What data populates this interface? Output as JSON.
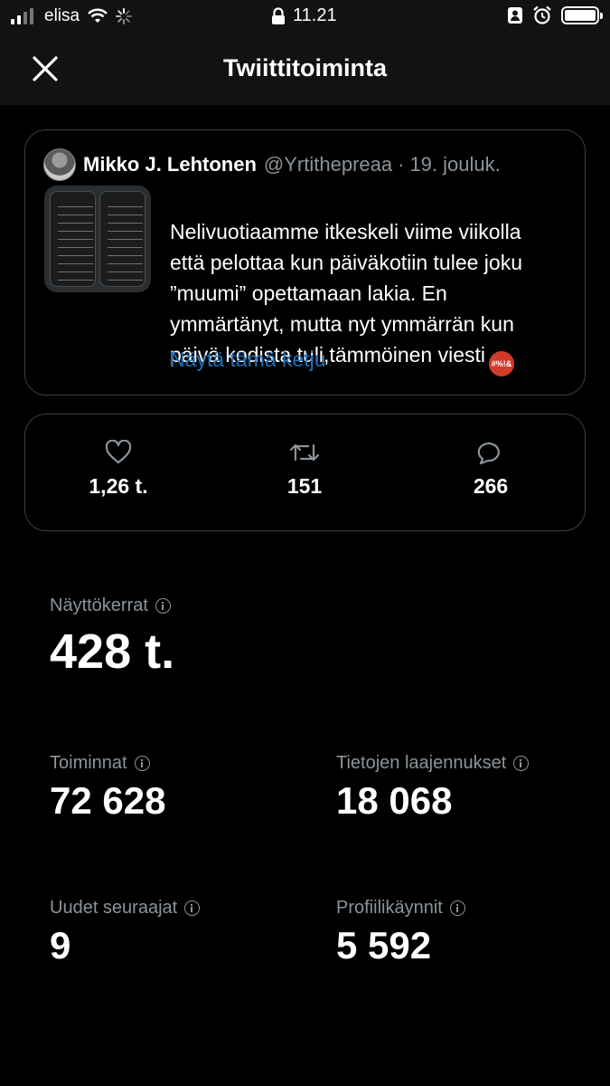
{
  "status_bar": {
    "carrier": "elisa",
    "time": "11.21"
  },
  "nav": {
    "title": "Twiittitoiminta"
  },
  "tweet": {
    "author": "Mikko J. Lehtonen",
    "handle": "@Yrtithepreaa",
    "separator": "·",
    "date": "19. jouluk.",
    "text": "Nelivuotiaamme itkeskeli viime viikolla\nettä pelottaa kun päiväkotiin tulee joku\n”muumi” opettamaan lakia. En\nymmärtänyt, mutta nyt ymmärrän kun\npäivä kodista tuli,tämmöinen viesti",
    "emoji_text": "#%!&",
    "show_thread": "Näytä tämä ketju"
  },
  "engagement": {
    "likes": "1,26 t.",
    "retweets": "151",
    "replies": "266"
  },
  "metrics": {
    "impressions_label": "Näyttökerrat",
    "impressions_value": "428 t.",
    "engagements_label": "Toiminnat",
    "engagements_value": "72 628",
    "detail_expands_label": "Tietojen laajennukset",
    "detail_expands_value": "18 068",
    "new_followers_label": "Uudet seuraajat",
    "new_followers_value": "9",
    "profile_visits_label": "Profiilikäynnit",
    "profile_visits_value": "5 592"
  },
  "colors": {
    "background": "#000000",
    "header_bg": "#121212",
    "link": "#1d6fb8",
    "muted": "#8b949a"
  }
}
